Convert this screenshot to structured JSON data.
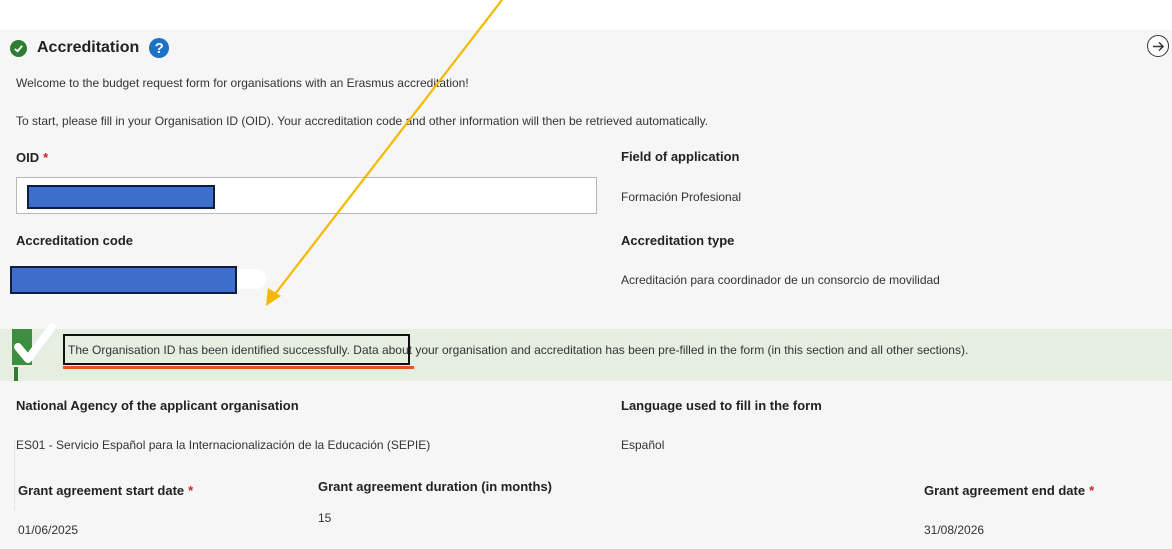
{
  "section": {
    "title": "Accreditation",
    "help_icon": "question-circle-icon",
    "status_icon": "check-circle-icon",
    "expand_icon": "arrow-right-circle-icon"
  },
  "intro": {
    "welcome": "Welcome to the budget request form for organisations with an Erasmus accreditation!",
    "instructions": "To start, please fill in your Organisation ID (OID). Your accreditation code and other information will then be retrieved automatically."
  },
  "fields": {
    "oid_label": "OID",
    "oid_required": "*",
    "field_of_application_label": "Field of application",
    "field_of_application_value": "Formación Profesional",
    "accreditation_code_label": "Accreditation code",
    "accreditation_type_label": "Accreditation type",
    "accreditation_type_value": "Acreditación para coordinador de un consorcio de movilidad",
    "national_agency_label": "National Agency of the applicant organisation",
    "national_agency_value": "ES01 - Servicio Español para la Internacionalización de la Educación (SEPIE)",
    "language_label": "Language used to fill in the form",
    "language_value": "Español",
    "start_date_label": "Grant agreement start date",
    "start_date_value": "01/06/2025",
    "duration_label": "Grant agreement duration (in months)",
    "duration_value": "15",
    "end_date_label": "Grant agreement end date",
    "end_date_value": "31/08/2026",
    "required_mark": "*"
  },
  "success": {
    "highlighted": "The Organisation ID has been identified successfully.",
    "rest": " Data about your organisation and accreditation has been pre-filled in the form (in this section and all other sections)."
  },
  "colors": {
    "panel_bg": "#f5f6f5",
    "success_bg": "#e6eee2",
    "success_check": "#2e7d32",
    "help_blue": "#1a73c7",
    "redaction": "#3c6fcb",
    "annotation_arrow": "#f5b800",
    "annotation_underline": "#e05a1e",
    "required": "#c62828"
  }
}
